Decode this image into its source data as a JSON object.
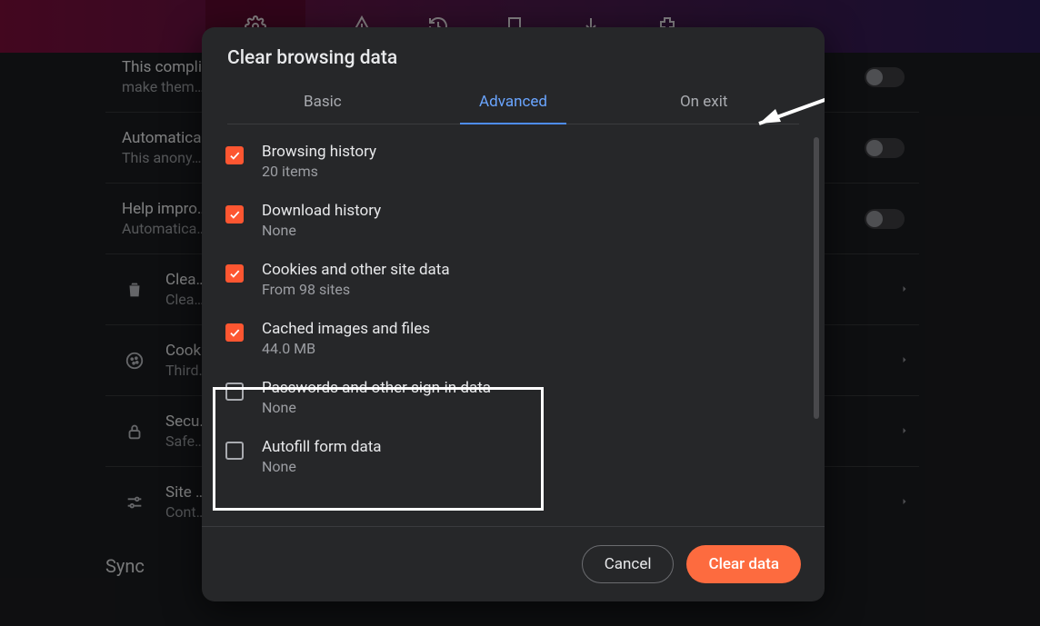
{
  "topbar": {
    "icons": [
      "settings-icon",
      "warning-icon",
      "history-icon",
      "bookmark-icon",
      "download-icon",
      "extension-icon"
    ]
  },
  "settings": {
    "rows": [
      {
        "title": "This complies with …",
        "sub": "make them…",
        "toggle": true
      },
      {
        "title": "Automatica…",
        "sub": "This anony…",
        "toggle": true
      },
      {
        "title": "Help impro…",
        "sub": "Automatica…",
        "toggle": true
      },
      {
        "icon": "trash-icon",
        "title": "Clea…",
        "sub": "Clea…",
        "chev": true
      },
      {
        "icon": "cookie-icon",
        "title": "Cook…",
        "sub": "Third…",
        "chev": true
      },
      {
        "icon": "lock-icon",
        "title": "Secu…",
        "sub": "Safe…",
        "chev": true
      },
      {
        "icon": "sliders-icon",
        "title": "Site …",
        "sub": "Cont…",
        "chev": true
      }
    ],
    "sync_heading": "Sync"
  },
  "modal": {
    "title": "Clear browsing data",
    "tabs": {
      "basic": "Basic",
      "advanced": "Advanced",
      "onexit": "On exit",
      "active": "advanced"
    },
    "options": [
      {
        "checked": true,
        "title": "Browsing history",
        "sub": "20 items"
      },
      {
        "checked": true,
        "title": "Download history",
        "sub": "None"
      },
      {
        "checked": true,
        "title": "Cookies and other site data",
        "sub": "From 98 sites"
      },
      {
        "checked": true,
        "title": "Cached images and files",
        "sub": "44.0 MB"
      },
      {
        "checked": false,
        "title": "Passwords and other sign-in data",
        "sub": "None"
      },
      {
        "checked": false,
        "title": "Autofill form data",
        "sub": "None"
      }
    ],
    "buttons": {
      "cancel": "Cancel",
      "clear": "Clear data"
    }
  }
}
